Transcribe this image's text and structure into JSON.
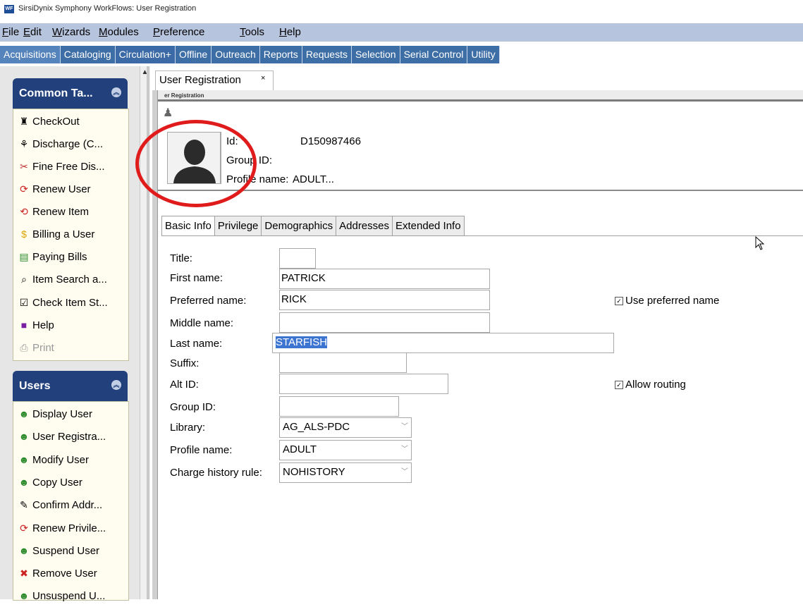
{
  "window": {
    "app_icon": "WF",
    "title": "SirsiDynix Symphony WorkFlows: User Registration"
  },
  "menu": [
    {
      "accel": "F",
      "rest": "ile"
    },
    {
      "accel": "E",
      "rest": "dit"
    },
    {
      "accel": "W",
      "rest": "izards"
    },
    {
      "accel": "M",
      "rest": "odules"
    },
    {
      "accel": "P",
      "rest": "reference"
    },
    {
      "accel": "T",
      "rest": "ools"
    },
    {
      "accel": "H",
      "rest": "elp"
    }
  ],
  "modules": [
    "Acquisitions",
    "Cataloging",
    "Circulation+",
    "Offline",
    "Outreach",
    "Reports",
    "Requests",
    "Selection",
    "Serial Control",
    "Utility"
  ],
  "sidebar": {
    "common_tasks": {
      "title": "Common Ta...",
      "items": [
        "CheckOut",
        "Discharge (C...",
        "Fine Free Dis...",
        "Renew User",
        "Renew Item",
        "Billing a User",
        "Paying Bills",
        "Item Search a...",
        "Check Item St...",
        "Help",
        "Print"
      ]
    },
    "users": {
      "title": "Users",
      "items": [
        "Display User",
        "User Registra...",
        "Modify User",
        "Copy User",
        "Confirm Addr...",
        "Renew Privile...",
        "Suspend User",
        "Remove User",
        "Unsuspend U..."
      ]
    }
  },
  "document_tab": {
    "label": "User Registration",
    "close": "×"
  },
  "subwindow_title": "er Registration",
  "user_header": {
    "id_label": "Id:",
    "id_value": "D150987466",
    "group_label": "Group ID:",
    "profile_label": "Profile name:",
    "profile_value": "ADULT..."
  },
  "form_tabs": [
    "Basic Info",
    "Privilege",
    "Demographics",
    "Addresses",
    "Extended Info"
  ],
  "form": {
    "title_label": "Title:",
    "title_value": "",
    "first_label": "First name:",
    "first_value": "PATRICK",
    "preferred_label": "Preferred name:",
    "preferred_value": "RICK",
    "use_preferred_label": "Use preferred name",
    "middle_label": "Middle name:",
    "middle_value": "",
    "last_label": "Last name:",
    "last_value": "STARFISH",
    "suffix_label": "Suffix:",
    "suffix_value": "",
    "altid_label": "Alt ID:",
    "altid_value": "",
    "allow_routing_label": "Allow routing",
    "groupid_label": "Group ID:",
    "groupid_value": "",
    "library_label": "Library:",
    "library_value": "AG_ALS-PDC",
    "profile_label": "Profile name:",
    "profile_value": "ADULT",
    "charge_label": "Charge history rule:",
    "charge_value": "NOHISTORY"
  },
  "colors": {
    "menubar": "#b7c4dd",
    "module_tab": "#3e6ea6",
    "panel_header": "#22407b",
    "annotation": "#e01b1b",
    "selection": "#3b74d1"
  }
}
